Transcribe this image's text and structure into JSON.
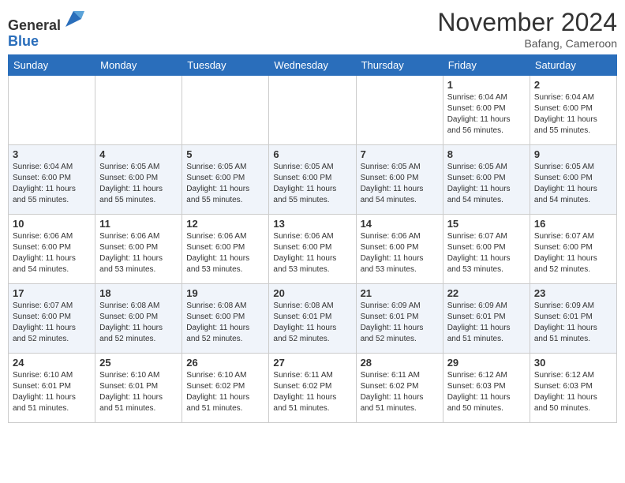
{
  "header": {
    "logo_line1": "General",
    "logo_line2": "Blue",
    "month": "November 2024",
    "location": "Bafang, Cameroon"
  },
  "weekdays": [
    "Sunday",
    "Monday",
    "Tuesday",
    "Wednesday",
    "Thursday",
    "Friday",
    "Saturday"
  ],
  "weeks": [
    [
      {
        "day": "",
        "info": ""
      },
      {
        "day": "",
        "info": ""
      },
      {
        "day": "",
        "info": ""
      },
      {
        "day": "",
        "info": ""
      },
      {
        "day": "",
        "info": ""
      },
      {
        "day": "1",
        "info": "Sunrise: 6:04 AM\nSunset: 6:00 PM\nDaylight: 11 hours\nand 56 minutes."
      },
      {
        "day": "2",
        "info": "Sunrise: 6:04 AM\nSunset: 6:00 PM\nDaylight: 11 hours\nand 55 minutes."
      }
    ],
    [
      {
        "day": "3",
        "info": "Sunrise: 6:04 AM\nSunset: 6:00 PM\nDaylight: 11 hours\nand 55 minutes."
      },
      {
        "day": "4",
        "info": "Sunrise: 6:05 AM\nSunset: 6:00 PM\nDaylight: 11 hours\nand 55 minutes."
      },
      {
        "day": "5",
        "info": "Sunrise: 6:05 AM\nSunset: 6:00 PM\nDaylight: 11 hours\nand 55 minutes."
      },
      {
        "day": "6",
        "info": "Sunrise: 6:05 AM\nSunset: 6:00 PM\nDaylight: 11 hours\nand 55 minutes."
      },
      {
        "day": "7",
        "info": "Sunrise: 6:05 AM\nSunset: 6:00 PM\nDaylight: 11 hours\nand 54 minutes."
      },
      {
        "day": "8",
        "info": "Sunrise: 6:05 AM\nSunset: 6:00 PM\nDaylight: 11 hours\nand 54 minutes."
      },
      {
        "day": "9",
        "info": "Sunrise: 6:05 AM\nSunset: 6:00 PM\nDaylight: 11 hours\nand 54 minutes."
      }
    ],
    [
      {
        "day": "10",
        "info": "Sunrise: 6:06 AM\nSunset: 6:00 PM\nDaylight: 11 hours\nand 54 minutes."
      },
      {
        "day": "11",
        "info": "Sunrise: 6:06 AM\nSunset: 6:00 PM\nDaylight: 11 hours\nand 53 minutes."
      },
      {
        "day": "12",
        "info": "Sunrise: 6:06 AM\nSunset: 6:00 PM\nDaylight: 11 hours\nand 53 minutes."
      },
      {
        "day": "13",
        "info": "Sunrise: 6:06 AM\nSunset: 6:00 PM\nDaylight: 11 hours\nand 53 minutes."
      },
      {
        "day": "14",
        "info": "Sunrise: 6:06 AM\nSunset: 6:00 PM\nDaylight: 11 hours\nand 53 minutes."
      },
      {
        "day": "15",
        "info": "Sunrise: 6:07 AM\nSunset: 6:00 PM\nDaylight: 11 hours\nand 53 minutes."
      },
      {
        "day": "16",
        "info": "Sunrise: 6:07 AM\nSunset: 6:00 PM\nDaylight: 11 hours\nand 52 minutes."
      }
    ],
    [
      {
        "day": "17",
        "info": "Sunrise: 6:07 AM\nSunset: 6:00 PM\nDaylight: 11 hours\nand 52 minutes."
      },
      {
        "day": "18",
        "info": "Sunrise: 6:08 AM\nSunset: 6:00 PM\nDaylight: 11 hours\nand 52 minutes."
      },
      {
        "day": "19",
        "info": "Sunrise: 6:08 AM\nSunset: 6:00 PM\nDaylight: 11 hours\nand 52 minutes."
      },
      {
        "day": "20",
        "info": "Sunrise: 6:08 AM\nSunset: 6:01 PM\nDaylight: 11 hours\nand 52 minutes."
      },
      {
        "day": "21",
        "info": "Sunrise: 6:09 AM\nSunset: 6:01 PM\nDaylight: 11 hours\nand 52 minutes."
      },
      {
        "day": "22",
        "info": "Sunrise: 6:09 AM\nSunset: 6:01 PM\nDaylight: 11 hours\nand 51 minutes."
      },
      {
        "day": "23",
        "info": "Sunrise: 6:09 AM\nSunset: 6:01 PM\nDaylight: 11 hours\nand 51 minutes."
      }
    ],
    [
      {
        "day": "24",
        "info": "Sunrise: 6:10 AM\nSunset: 6:01 PM\nDaylight: 11 hours\nand 51 minutes."
      },
      {
        "day": "25",
        "info": "Sunrise: 6:10 AM\nSunset: 6:01 PM\nDaylight: 11 hours\nand 51 minutes."
      },
      {
        "day": "26",
        "info": "Sunrise: 6:10 AM\nSunset: 6:02 PM\nDaylight: 11 hours\nand 51 minutes."
      },
      {
        "day": "27",
        "info": "Sunrise: 6:11 AM\nSunset: 6:02 PM\nDaylight: 11 hours\nand 51 minutes."
      },
      {
        "day": "28",
        "info": "Sunrise: 6:11 AM\nSunset: 6:02 PM\nDaylight: 11 hours\nand 51 minutes."
      },
      {
        "day": "29",
        "info": "Sunrise: 6:12 AM\nSunset: 6:03 PM\nDaylight: 11 hours\nand 50 minutes."
      },
      {
        "day": "30",
        "info": "Sunrise: 6:12 AM\nSunset: 6:03 PM\nDaylight: 11 hours\nand 50 minutes."
      }
    ]
  ]
}
